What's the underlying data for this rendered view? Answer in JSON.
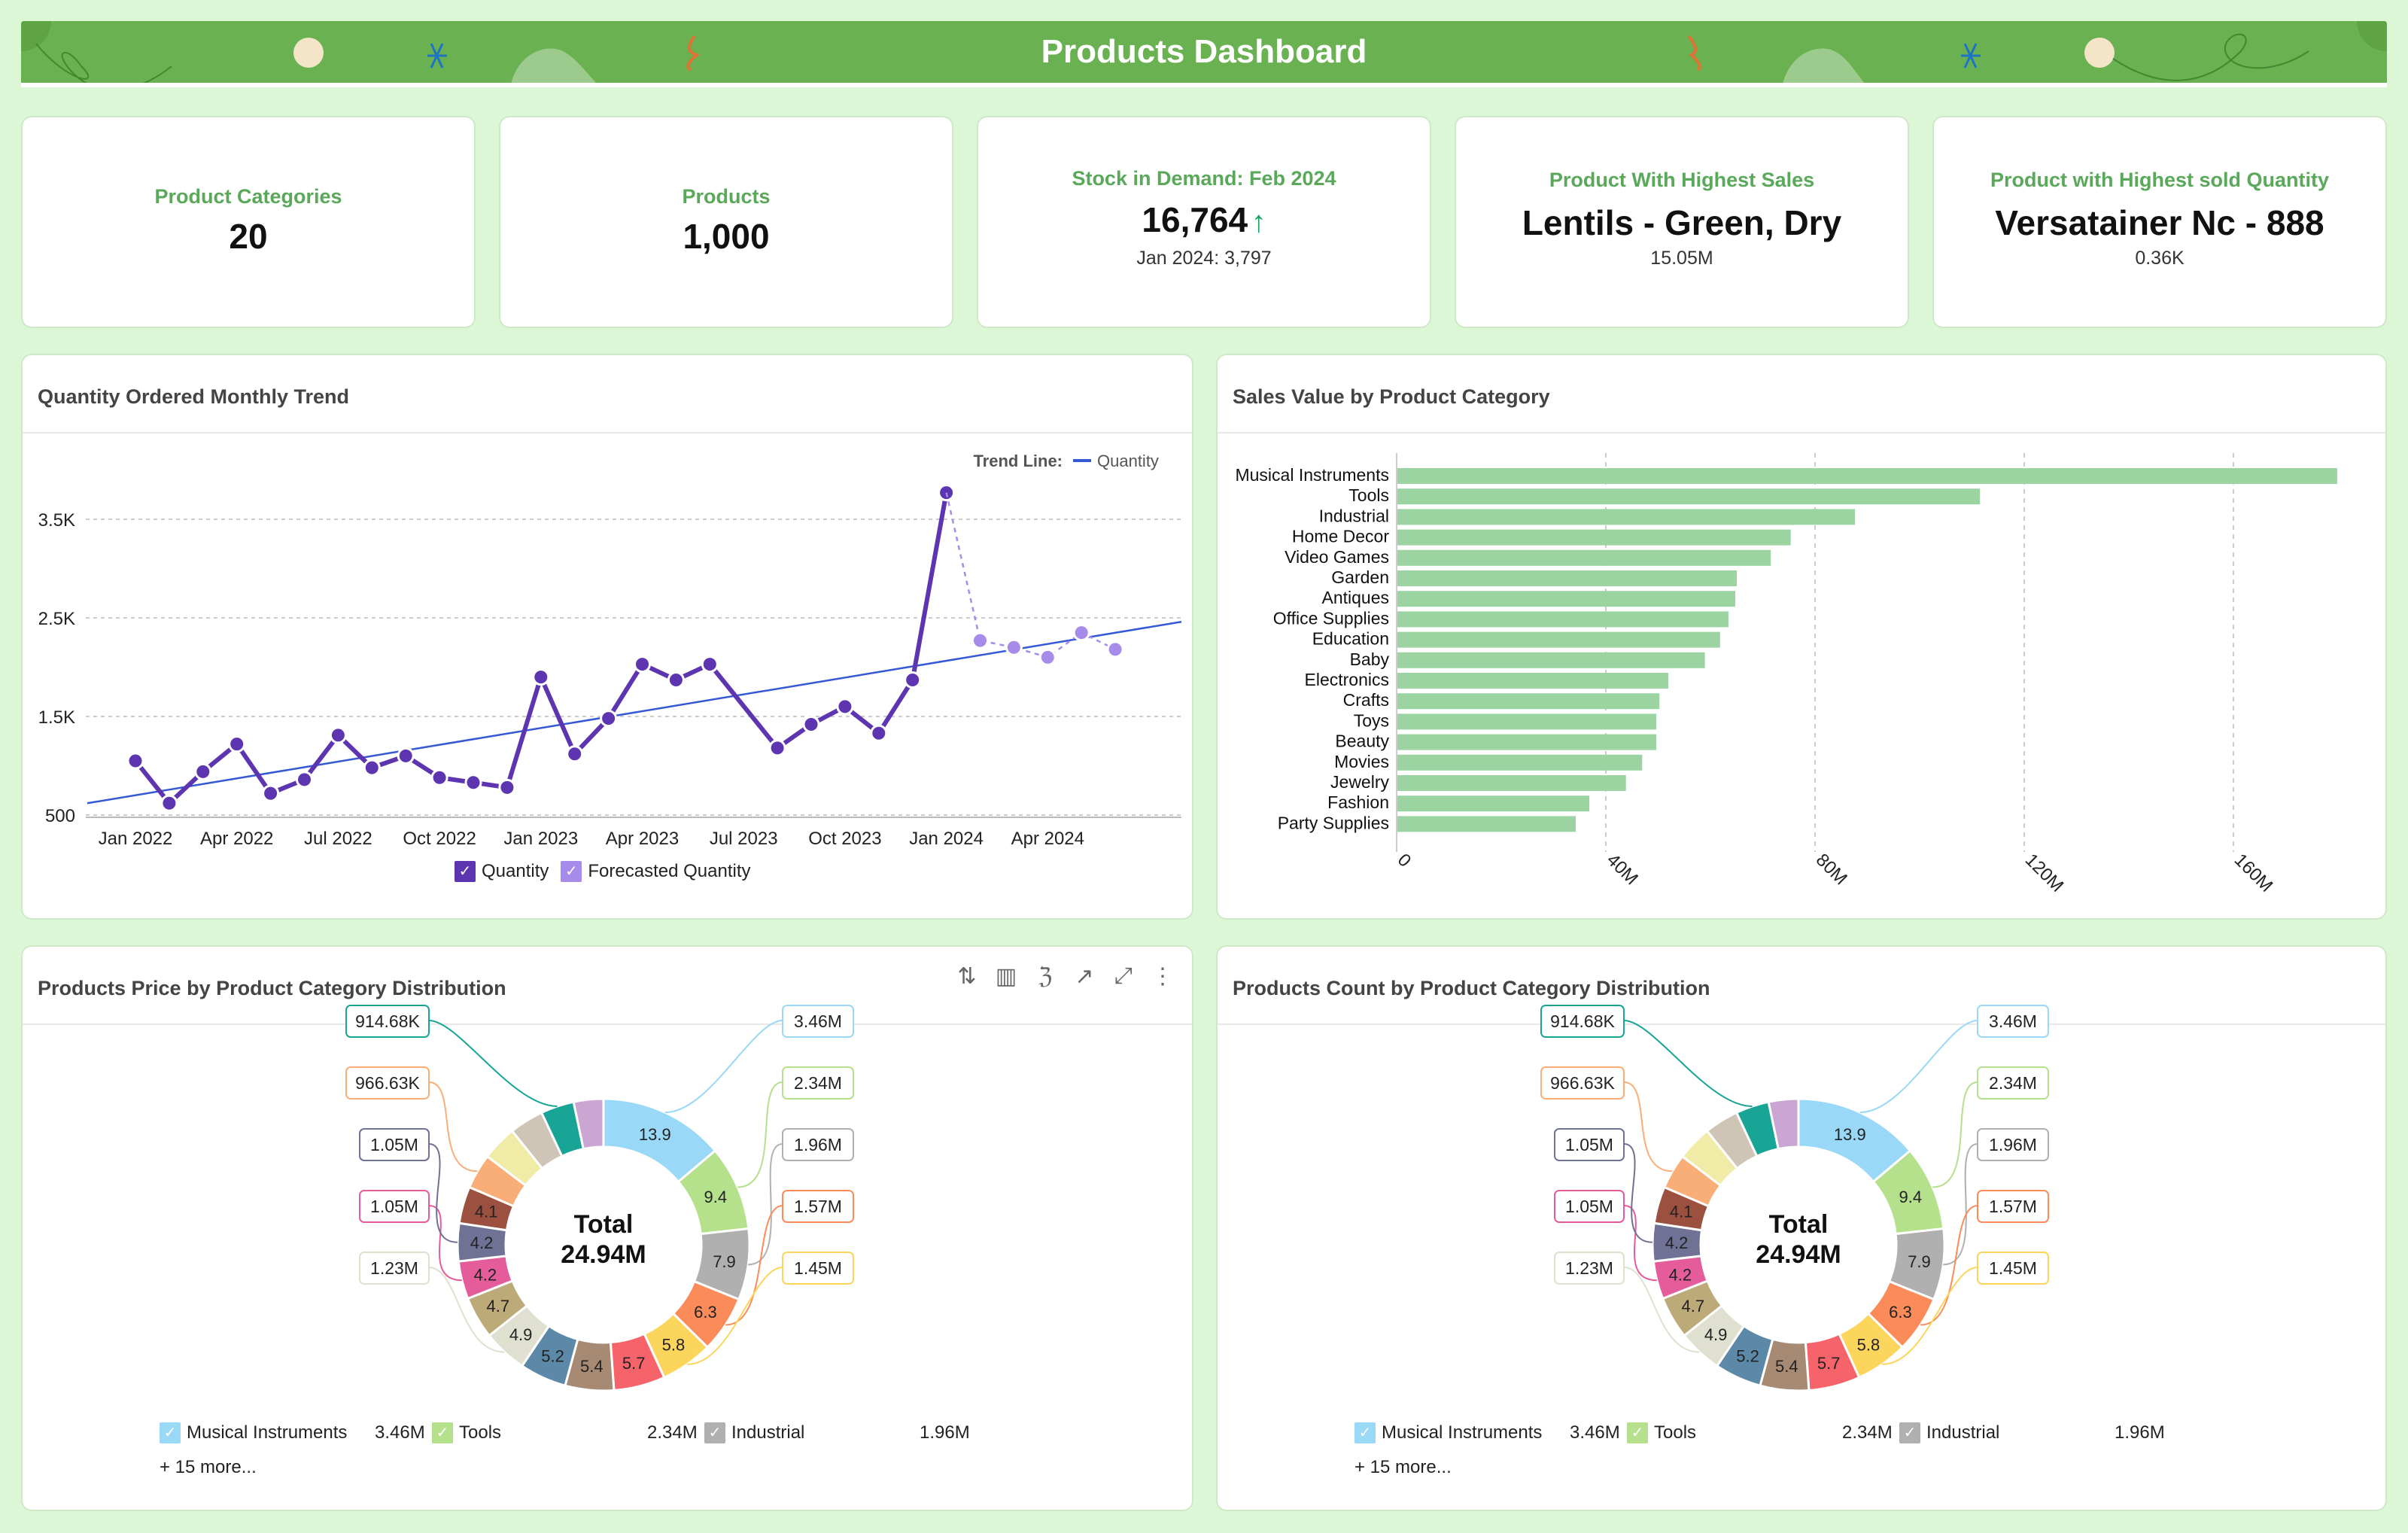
{
  "header": {
    "title": "Products Dashboard"
  },
  "kpis": [
    {
      "title": "Product Categories",
      "value": "20"
    },
    {
      "title": "Products",
      "value": "1,000"
    },
    {
      "title": "Stock in Demand: Feb 2024",
      "value": "16,764",
      "trend": "up",
      "sub": "Jan 2024: 3,797"
    },
    {
      "title": "Product With Highest Sales",
      "value": "Lentils - Green, Dry",
      "sub": "15.05M"
    },
    {
      "title": "Product with Highest sold Quantity",
      "value": "Versatainer Nc - 888",
      "sub": "0.36K"
    }
  ],
  "panels": {
    "trend": {
      "title": "Quantity Ordered Monthly Trend",
      "trend_label": "Trend Line:",
      "trend_series": "Quantity"
    },
    "sales": {
      "title": "Sales Value by Product Category"
    },
    "price": {
      "title": "Products Price by Product Category Distribution",
      "more": "+ 15 more..."
    },
    "count": {
      "title": "Products Count by Product Category Distribution",
      "more": "+ 15 more..."
    }
  },
  "toolbar": {
    "icons": [
      "sort-icon",
      "bar-chart-icon",
      "zia-icon",
      "open-external-icon",
      "expand-icon",
      "more-icon"
    ]
  },
  "colors": {
    "accent": "#6ab151",
    "quantity": "#5e35b1",
    "forecast": "#a78bea",
    "trend": "#3558d4",
    "bar": "#9bd3a1"
  },
  "chart_data": [
    {
      "type": "line",
      "title": "Quantity Ordered Monthly Trend",
      "x": [
        "Jan 2022",
        "Feb 2022",
        "Mar 2022",
        "Apr 2022",
        "May 2022",
        "Jun 2022",
        "Jul 2022",
        "Aug 2022",
        "Sep 2022",
        "Oct 2022",
        "Nov 2022",
        "Dec 2022",
        "Jan 2023",
        "Feb 2023",
        "Mar 2023",
        "Apr 2023",
        "May 2023",
        "Jun 2023",
        "Jul 2023",
        "Aug 2023",
        "Sep 2023",
        "Oct 2023",
        "Nov 2023",
        "Dec 2023",
        "Jan 2024",
        "Feb 2024",
        "Mar 2024",
        "Apr 2024",
        "May 2024",
        "Jun 2024"
      ],
      "xticks": [
        "Jan 2022",
        "Apr 2022",
        "Jul 2022",
        "Oct 2022",
        "Jan 2023",
        "Apr 2023",
        "Jul 2023",
        "Oct 2023",
        "Jan 2024",
        "Apr 2024"
      ],
      "yticks": [
        "500",
        "1.5K",
        "2.5K",
        "3.5K"
      ],
      "ylim": [
        500,
        3800
      ],
      "series": [
        {
          "name": "Quantity",
          "values": [
            1050,
            620,
            940,
            1220,
            720,
            860,
            1310,
            980,
            1100,
            880,
            830,
            780,
            1900,
            1120,
            1480,
            2030,
            1870,
            2030,
            null,
            1180,
            1420,
            1600,
            1330,
            1870,
            3770,
            null,
            null,
            null,
            null,
            null
          ]
        },
        {
          "name": "Forecasted Quantity",
          "values": [
            null,
            null,
            null,
            null,
            null,
            null,
            null,
            null,
            null,
            null,
            null,
            null,
            null,
            null,
            null,
            null,
            null,
            null,
            null,
            null,
            null,
            null,
            null,
            null,
            3770,
            2270,
            2200,
            2100,
            2350,
            2180
          ]
        }
      ],
      "trend_line": {
        "name": "Quantity",
        "start": 620,
        "end": 2460
      },
      "legend": [
        "Quantity",
        "Forecasted Quantity"
      ]
    },
    {
      "type": "bar",
      "orientation": "horizontal",
      "title": "Sales Value by Product Category",
      "categories": [
        "Musical Instruments",
        "Tools",
        "Industrial",
        "Home Decor",
        "Video Games",
        "Garden",
        "Antiques",
        "Office Supplies",
        "Education",
        "Baby",
        "Electronics",
        "Crafts",
        "Toys",
        "Beauty",
        "Movies",
        "Jewelry",
        "Fashion",
        "Party Supplies"
      ],
      "values": [
        179.7,
        111.4,
        87.5,
        75.2,
        71.4,
        64.9,
        64.6,
        63.3,
        61.7,
        58.8,
        51.8,
        50.1,
        49.5,
        49.5,
        46.8,
        43.7,
        36.7,
        34.1
      ],
      "unit": "M",
      "xticks": [
        "0",
        "40M",
        "80M",
        "120M",
        "160M"
      ],
      "xlim": [
        0,
        200
      ]
    },
    {
      "type": "pie",
      "donut": true,
      "title": "Products Price by Product Category Distribution",
      "center_label": "Total",
      "center_value": "24.94M",
      "slices": [
        {
          "label": "Musical Instruments",
          "pct": 13.9,
          "value": "3.46M",
          "color": "#99d8f7"
        },
        {
          "label": "Tools",
          "pct": 9.4,
          "value": "2.34M",
          "color": "#b5e08c"
        },
        {
          "label": "Industrial",
          "pct": 7.9,
          "value": "1.96M",
          "color": "#b0b0b0"
        },
        {
          "label": "",
          "pct": 6.3,
          "value": "1.57M",
          "color": "#fb8c5a"
        },
        {
          "label": "",
          "pct": 5.8,
          "value": "1.45M",
          "color": "#fcd55c"
        },
        {
          "label": "",
          "pct": 5.7,
          "value": "",
          "color": "#f7636a"
        },
        {
          "label": "",
          "pct": 5.4,
          "value": "",
          "color": "#a68a74"
        },
        {
          "label": "",
          "pct": 5.2,
          "value": "",
          "color": "#5d89a8"
        },
        {
          "label": "",
          "pct": 4.9,
          "value": "1.23M",
          "color": "#dfe0cf"
        },
        {
          "label": "",
          "pct": 4.7,
          "value": "",
          "color": "#bcaa78"
        },
        {
          "label": "",
          "pct": 4.2,
          "value": "1.05M",
          "color": "#e55c9a"
        },
        {
          "label": "",
          "pct": 4.2,
          "value": "1.05M",
          "color": "#6f7195"
        },
        {
          "label": "",
          "pct": 4.1,
          "value": "",
          "color": "#9c5140"
        },
        {
          "label": "",
          "pct": 3.9,
          "value": "966.63K",
          "color": "#f9ae78"
        },
        {
          "label": "",
          "pct": 3.9,
          "value": "",
          "color": "#f1eba8"
        },
        {
          "label": "",
          "pct": 3.8,
          "value": "",
          "color": "#cfc5b6"
        },
        {
          "label": "",
          "pct": 3.7,
          "value": "914.68K",
          "color": "#18a596"
        },
        {
          "label": "",
          "pct": 3.3,
          "value": "",
          "color": "#cba6d2"
        }
      ],
      "legend": [
        {
          "label": "Musical Instruments",
          "value": "3.46M"
        },
        {
          "label": "Tools",
          "value": "2.34M"
        },
        {
          "label": "Industrial",
          "value": "1.96M"
        }
      ],
      "legend_more": "+ 15 more..."
    },
    {
      "type": "pie",
      "donut": true,
      "title": "Products Count by Product Category Distribution",
      "center_label": "Total",
      "center_value": "24.94M",
      "slices": "same as Products Price by Product Category Distribution",
      "legend": [
        {
          "label": "Musical Instruments",
          "value": "3.46M"
        },
        {
          "label": "Tools",
          "value": "2.34M"
        },
        {
          "label": "Industrial",
          "value": "1.96M"
        }
      ],
      "legend_more": "+ 15 more..."
    }
  ]
}
